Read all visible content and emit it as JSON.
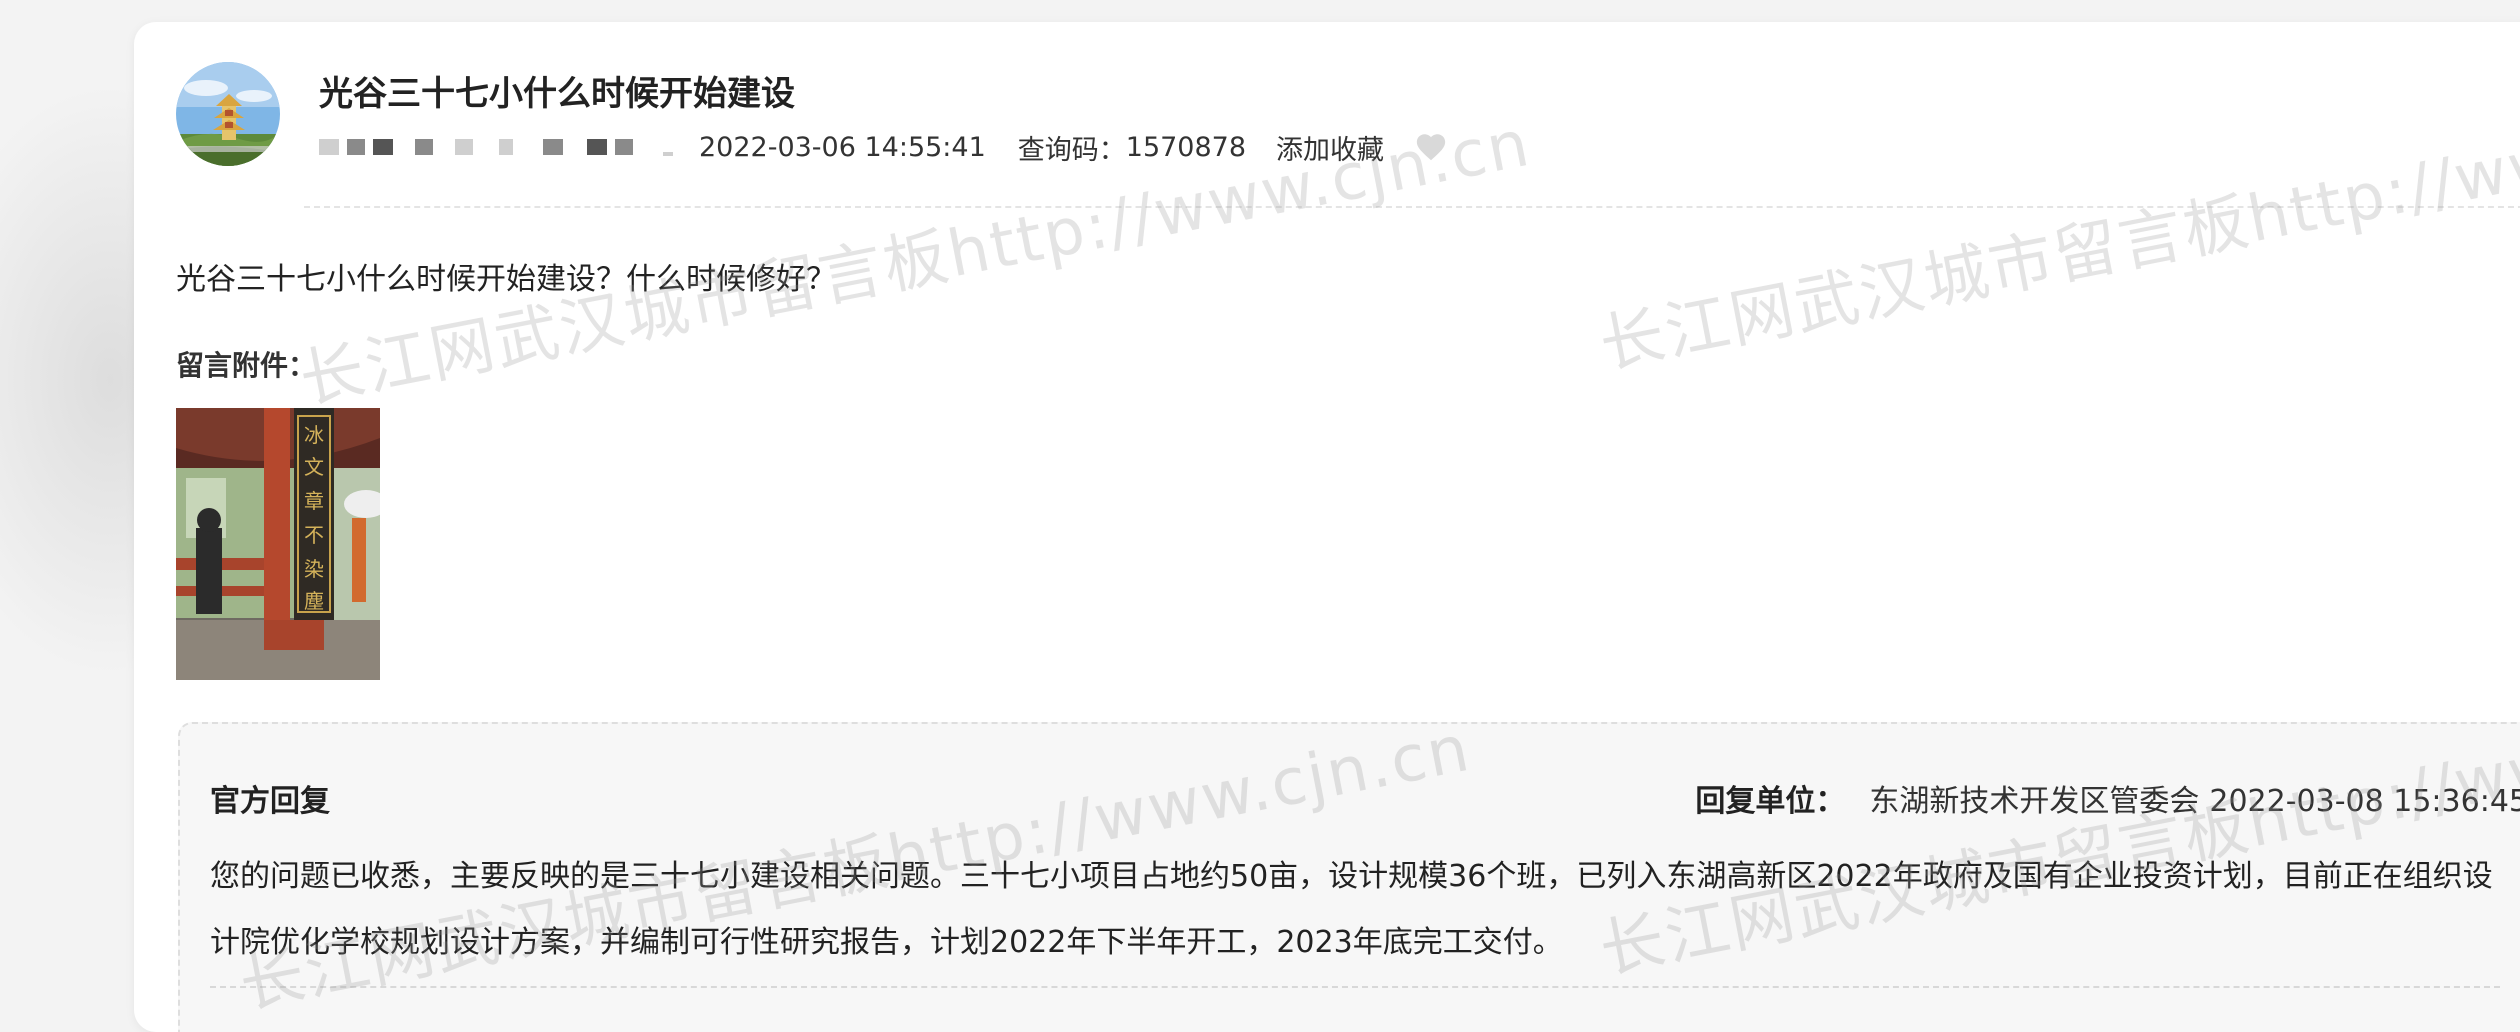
{
  "post": {
    "title": "光谷三十七小什么时候开始建设",
    "time": "2022-03-06 14:55:41",
    "query_code_label": "查询码：",
    "query_code": "1570878",
    "favorite_label": "添加收藏",
    "question": "光谷三十七小什么时候开始建设？什么时候修好？",
    "attachment_label": "留言附件："
  },
  "reply": {
    "title": "官方回复",
    "unit_label": "回复单位：",
    "unit": "东湖新技术开发区管委会",
    "time": "2022-03-08 15:36:45",
    "body": "您的问题已收悉，主要反映的是三十七小建设相关问题。三十七小项目占地约50亩，设计规模36个班，已列入东湖高新区2022年政府及国有企业投资计划，目前正在组织设计院优化学校规划设计方案，并编制可行性研究报告，计划2022年下半年开工，2023年底完工交付。"
  },
  "watermark": {
    "text_a": "长江网武汉城市留言板http://www.cjn.cn",
    "text_b": "长江网武汉城市留言板http://www"
  },
  "icons": {
    "favorite": "heart-icon",
    "avatar": "yellow-crane-tower-avatar"
  },
  "colors": {
    "heart": "#d9d9d9",
    "reply_bg": "#f7f7f7",
    "watermark": "#969696"
  }
}
